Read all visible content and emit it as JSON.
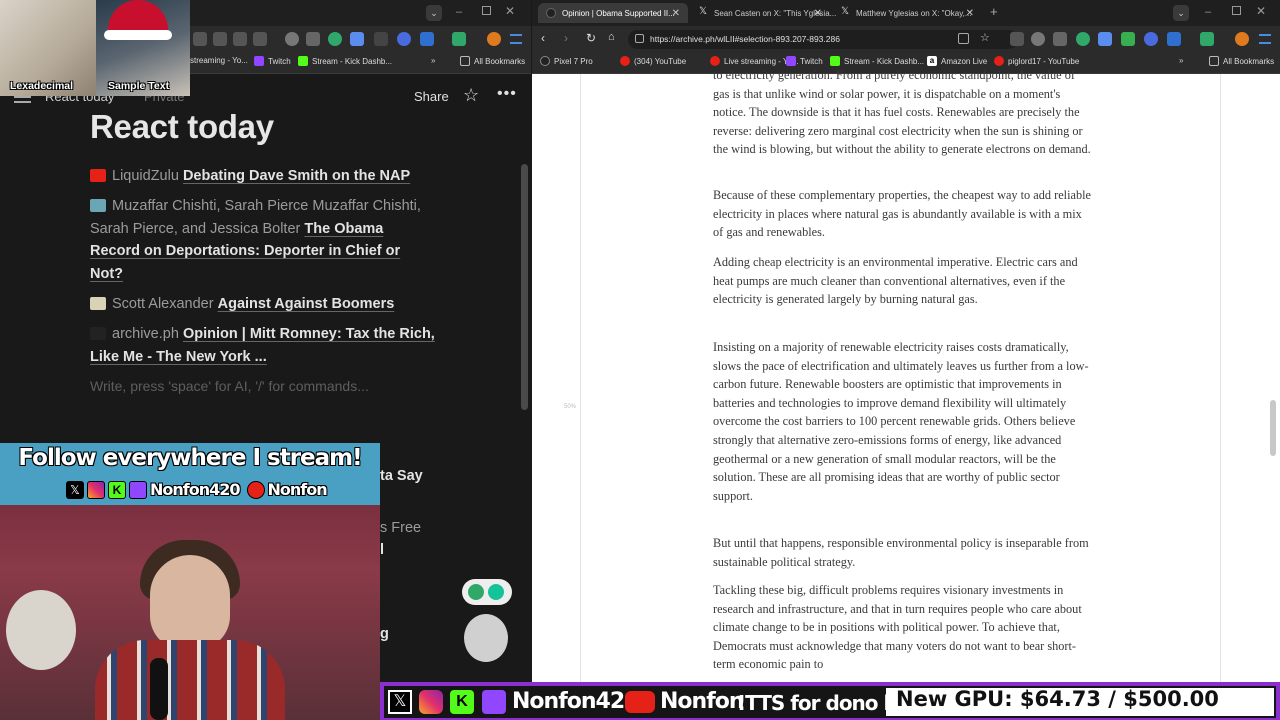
{
  "left_browser": {
    "bookmarks": [
      "streaming - Yo...",
      "Twitch",
      "Stream - Kick Dashb...",
      "All Bookmarks"
    ],
    "colors": {
      "tab_bg": "#1f1f1f",
      "toolbar_bg": "#2b2b2b"
    }
  },
  "notion": {
    "breadcrumb": "React today",
    "privacy": "Private",
    "share_label": "Share",
    "page_title": "React today",
    "items": [
      {
        "source": "LiquidZulu",
        "title": "Debating Dave Smith on the NAP",
        "icon": "youtube-icon"
      },
      {
        "source": "Muzaffar Chishti, Sarah Pierce Muzaffar Chishti, Sarah Pierce, and Jessica Bolter",
        "title": "The Obama Record on Deportations: Deporter in Chief or Not?",
        "icon": "article-icon"
      },
      {
        "source": "Scott Alexander",
        "title": "Against Against Boomers",
        "icon": "newspaper-icon"
      },
      {
        "source": "archive.ph",
        "title": "Opinion | Mitt Romney: Tax the Rich, Like Me - The New York ...",
        "icon": "archive-icon"
      }
    ],
    "placeholder": "Write, press 'space' for AI, '/' for commands...",
    "partial_items": [
      "ta Say",
      "s Free",
      "l",
      "g"
    ]
  },
  "stream": {
    "cam_labels": [
      "Lexadecimal",
      "Sample Text"
    ],
    "follow_title": "Follow everywhere I stream!",
    "handle_primary": "Nonfon420",
    "handle_youtube": "Nonfon",
    "bottom_handle": "Nonfon420",
    "bottom_youtube": "Nonfon",
    "tts_text": "!TTS for dono link",
    "gpu_goal": "New GPU: $64.73 / $500.00",
    "colors": {
      "follow_bg": "#4aa0c2",
      "bar_border": "#8b2fd0"
    }
  },
  "right_browser": {
    "tabs": [
      {
        "label": "Opinion | Obama Supported II...",
        "active": true
      },
      {
        "label": "Sean Casten on X: \"This Yglesia...",
        "active": false
      },
      {
        "label": "Matthew Yglesias on X: \"Okay,...",
        "active": false
      }
    ],
    "url": "https://archive.ph/wlLII#selection-893.207-893.286",
    "bookmarks": [
      "Pixel 7 Pro",
      "(304) YouTube",
      "Live streaming - Yo...",
      "Twitch",
      "Stream - Kick Dashb...",
      "Amazon Live",
      "piglord17 - YouTube",
      "All Bookmarks"
    ]
  },
  "article": {
    "zoom_marker": "50%",
    "paragraphs": [
      "to electricity generation. From a purely economic standpoint, the value of gas is that unlike wind or solar power, it is dispatchable on a moment's notice. The downside is that it has fuel costs. Renewables are precisely the reverse: delivering zero marginal cost electricity when the sun is shining or the wind is blowing, but without the ability to generate electrons on demand.",
      "Because of these complementary properties, the cheapest way to add reliable electricity in places where natural gas is abundantly available is with a mix of gas and renewables.",
      "Adding cheap electricity is an environmental imperative. Electric cars and heat pumps are much cleaner than conventional alternatives, even if the electricity is generated largely by burning natural gas.",
      "Insisting on a majority of renewable electricity raises costs dramatically, slows the pace of electrification and ultimately leaves us further from a low-carbon future. Renewable boosters are optimistic that improvements in batteries and technologies to improve demand flexibility will ultimately overcome the cost barriers to 100 percent renewable grids. Others believe strongly that alternative zero-emissions forms of energy, like advanced geothermal or a new generation of small modular reactors, will be the solution. These are all promising ideas that are worthy of public sector support.",
      "But until that happens, responsible environmental policy is inseparable from sustainable political strategy.",
      "Tackling these big, difficult problems requires visionary investments in research and infrastructure, and that in turn requires people who care about climate change to be in positions with political power. To achieve that, Democrats must acknowledge that many voters do not want to bear short-term economic pain to"
    ]
  }
}
